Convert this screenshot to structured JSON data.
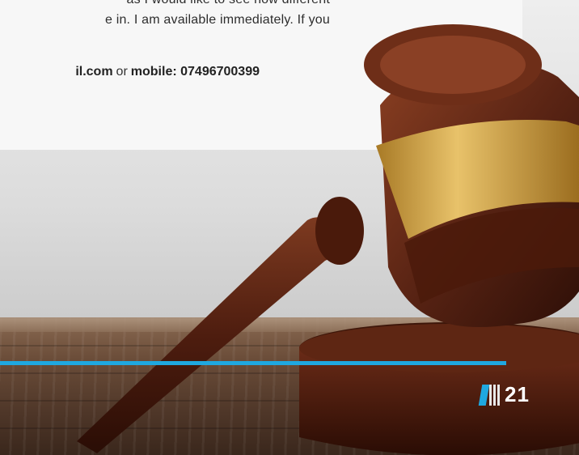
{
  "body_text": {
    "line1": "as I would like to see how different",
    "line2": "e in. I am available immediately. If you"
  },
  "contact": {
    "email_fragment": "il.com",
    "connector": "or",
    "mobile": "mobile: 07496700399"
  },
  "page_number": "21",
  "colors": {
    "accent_blue": "#1fa8e0",
    "wood_dark": "#4e3628",
    "gavel_brown": "#5a2414",
    "brass": "#d4a441"
  },
  "icons": [
    "publisher-logo-icon",
    "gavel-image"
  ]
}
